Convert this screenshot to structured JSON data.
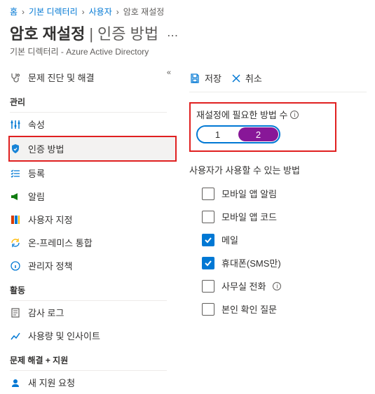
{
  "breadcrumb": {
    "home": "홈",
    "dir": "기본 디렉터리",
    "users": "사용자",
    "current": "암호 재설정"
  },
  "title": {
    "main": "암호 재설정",
    "sub": "인증 방법",
    "subtitle": "기본 디렉터리 - Azure Active Directory"
  },
  "sidebar": {
    "diag": "문제 진단 및 해결",
    "groups": {
      "manage": "관리",
      "activity": "활동",
      "support": "문제 해결 + 지원"
    },
    "items": {
      "properties": "속성",
      "auth_methods": "인증 방법",
      "registration": "등록",
      "notifications": "알림",
      "customization": "사용자 지정",
      "onprem": "온-프레미스 통합",
      "admin_policy": "관리자 정책",
      "audit_logs": "감사 로그",
      "usage": "사용량 및 인사이트",
      "new_support": "새 지원 요청"
    }
  },
  "actions": {
    "save": "저장",
    "discard": "취소"
  },
  "fields": {
    "methods_required_label": "재설정에 필요한 방법 수",
    "option1": "1",
    "option2": "2",
    "available_label": "사용자가 사용할 수 있는 방법",
    "mobile_notif": "모바일 앱 알림",
    "mobile_code": "모바일 앱 코드",
    "email": "메일",
    "phone_sms": "휴대폰(SMS만)",
    "office_phone": "사무실 전화",
    "security_questions": "본인 확인 질문"
  }
}
